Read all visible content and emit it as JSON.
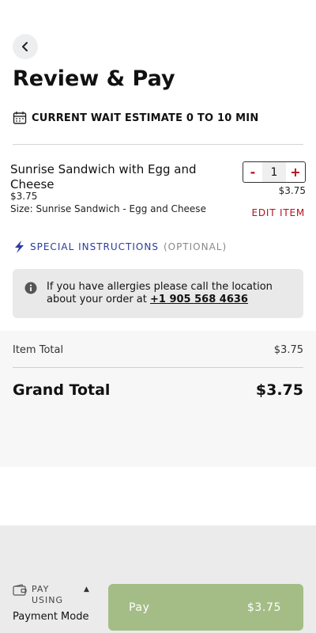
{
  "header": {
    "title": "Review & Pay",
    "back_icon": "chevron-left-icon"
  },
  "wait": {
    "icon": "calendar-icon",
    "text": "CURRENT WAIT ESTIMATE 0 TO 10 MIN"
  },
  "cart": {
    "items": [
      {
        "name": "Sunrise Sandwich with Egg and Cheese",
        "price": "$3.75",
        "size": "Size: Sunrise Sandwich - Egg and Cheese",
        "quantity": "1",
        "minus_label": "-",
        "plus_label": "+",
        "line_total": "$3.75",
        "edit_label": "EDIT ITEM"
      }
    ]
  },
  "special": {
    "icon": "lightning-icon",
    "label": "SPECIAL INSTRUCTIONS",
    "optional": "(OPTIONAL)"
  },
  "allergy": {
    "icon": "info-icon",
    "text": "If you have allergies please call the location about your order at ",
    "phone": "+1 905 568 4636"
  },
  "totals": {
    "item_total_label": "Item Total",
    "item_total_value": "$3.75",
    "grand_total_label": "Grand Total",
    "grand_total_value": "$3.75"
  },
  "footer": {
    "pay_using_icon": "wallet-icon",
    "pay_using_label": "PAY USING",
    "caret_icon": "caret-up-icon",
    "payment_mode": "Payment Mode",
    "pay_label": "Pay",
    "pay_amount": "$3.75"
  },
  "colors": {
    "accent_red": "#b5121b",
    "link_blue": "#2a3a9e",
    "pay_button": "#a4bd86"
  }
}
